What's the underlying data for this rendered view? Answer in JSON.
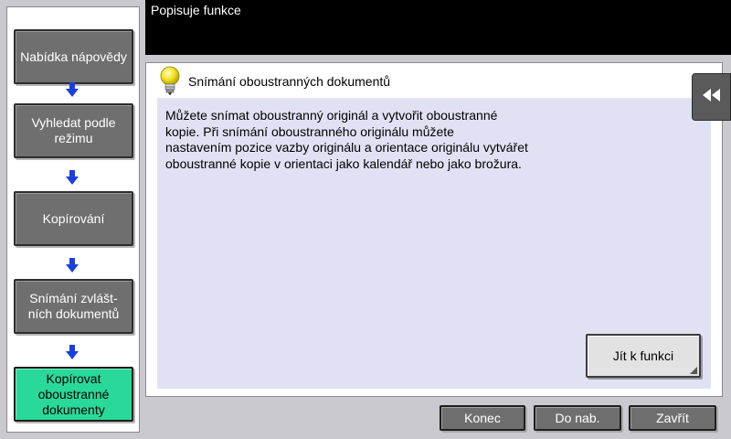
{
  "top_bar": {
    "title": "Popisuje funkce"
  },
  "nav": {
    "items": [
      {
        "label_lines": [
          "Nabídka nápovědy"
        ]
      },
      {
        "label_lines": [
          "Vyhledat podle",
          "režimu"
        ]
      },
      {
        "label_lines": [
          "Kopírování"
        ]
      },
      {
        "label_lines": [
          "Snímání zvlášt-",
          "ních dokumentů"
        ]
      },
      {
        "label_lines": [
          "Kopírovat",
          "oboustranné",
          "dokumenty"
        ]
      }
    ],
    "active_index": 4
  },
  "content": {
    "header": "Snímání oboustranných dokumentů",
    "description_lines": [
      "Můžete snímat oboustranný originál a vytvořit oboustranné",
      "kopie. Při snímání oboustranného originálu můžete",
      "nastavením pozice vazby originálu a orientace originálu vytvářet",
      "oboustranné kopie v orientaci jako kalendář nebo jako brožura."
    ],
    "goto_button": "Jít k funkci"
  },
  "footer": {
    "end": "Konec",
    "to_menu": "Do nab.",
    "close": "Zavřít"
  },
  "icons": {
    "step_arrow": "arrow-down-icon",
    "bulb": "lightbulb-icon",
    "collapse": "double-chevron-left-icon"
  },
  "colors": {
    "active_nav": "#29d99a",
    "nav_button": "#6f6f6f",
    "arrow": "#1a3fe0",
    "content_background": "#e0e2f4"
  }
}
